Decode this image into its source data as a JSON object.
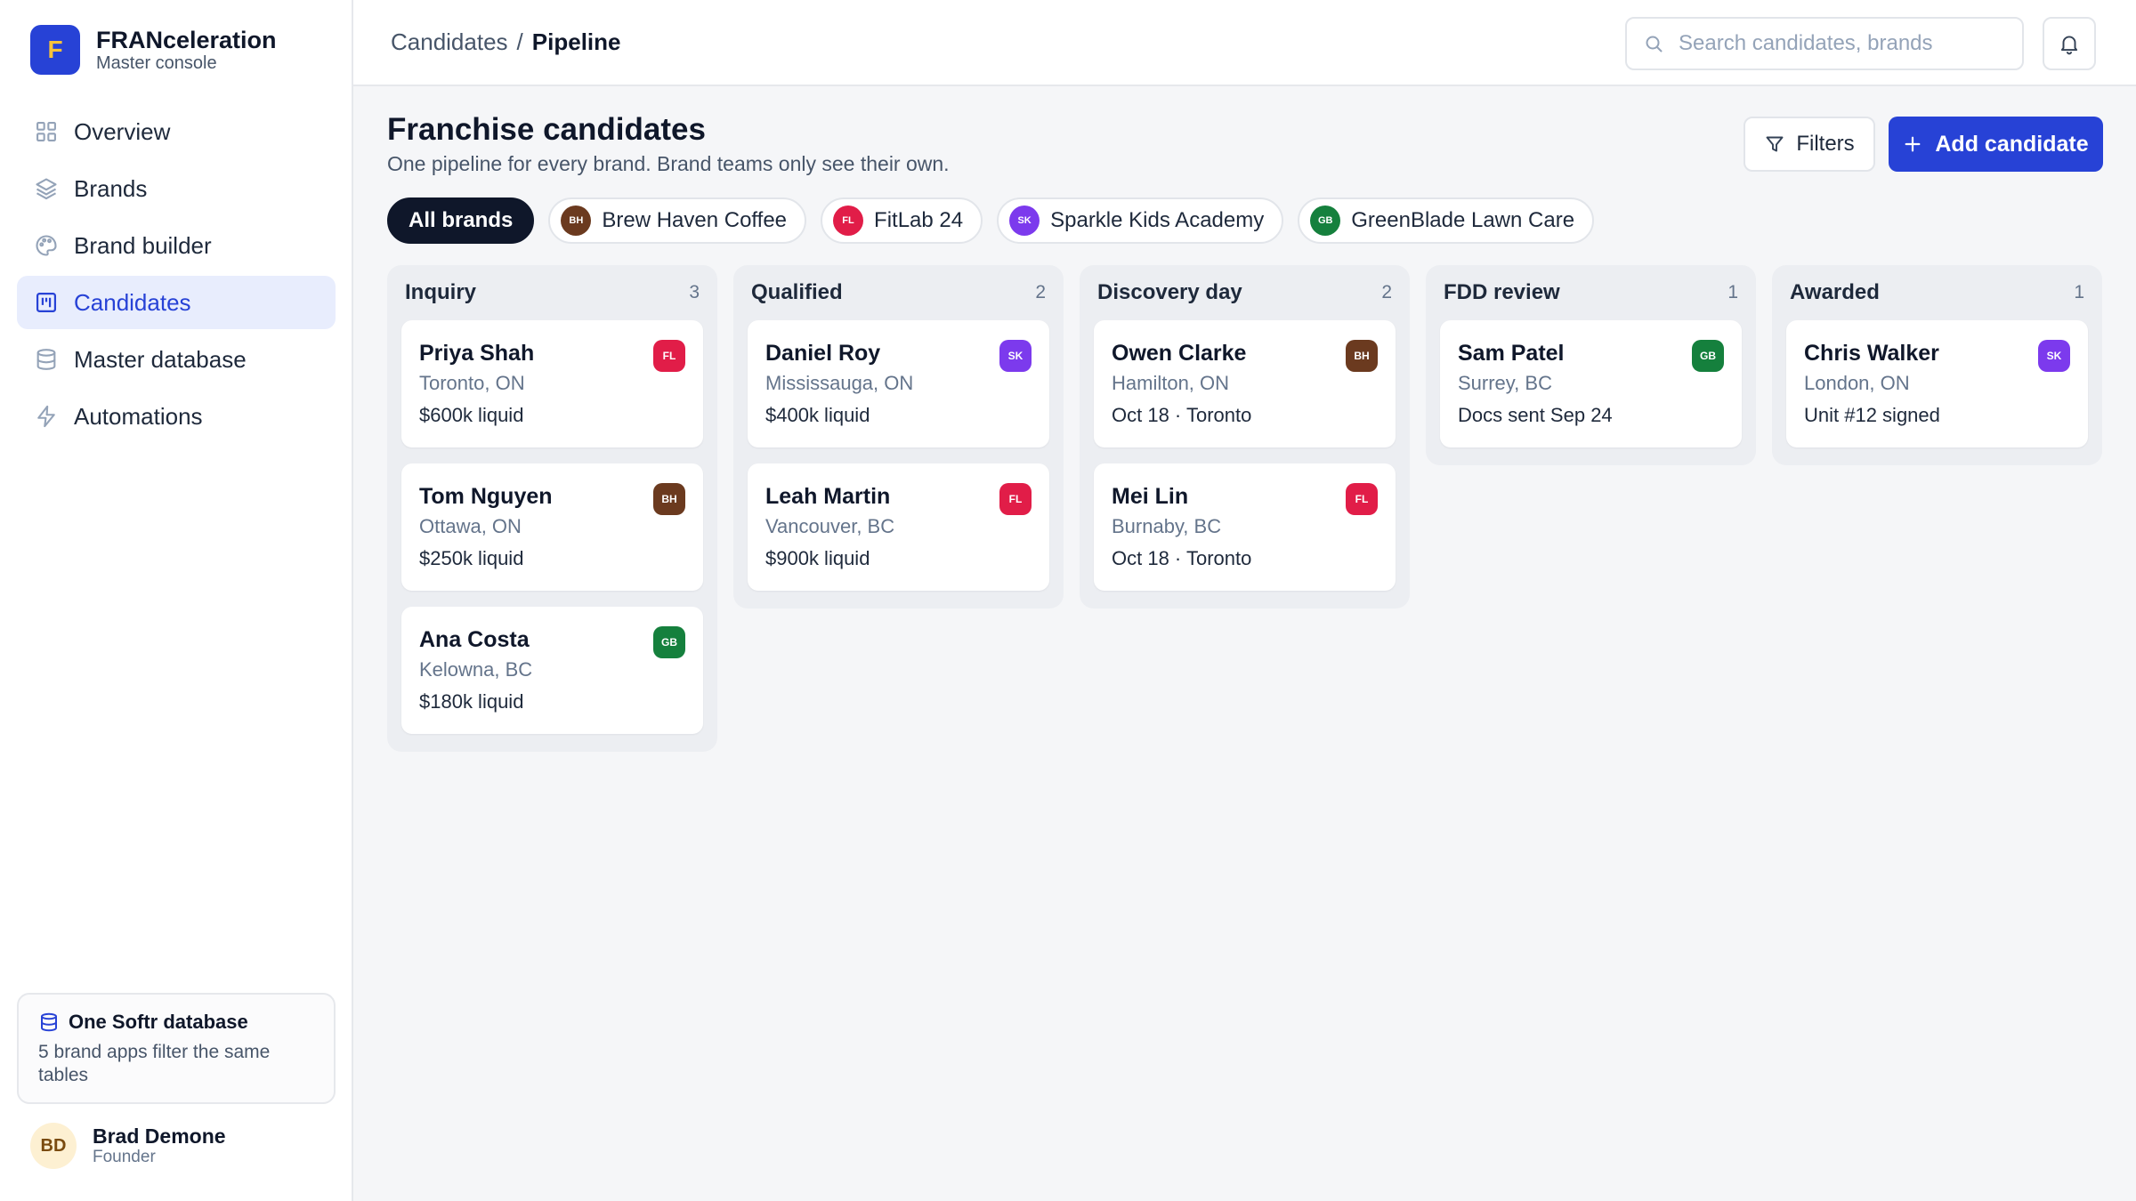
{
  "app": {
    "name": "FRANceleration",
    "subtitle": "Master console",
    "logo_letter": "F"
  },
  "colors": {
    "primary": "#2742d6",
    "logo_letter": "#f8c23a",
    "brew_haven": "#6b3a1f",
    "fitlab": "#e11d48",
    "sparkle": "#7c3aed",
    "greenblade": "#15803d"
  },
  "nav": {
    "items": [
      {
        "label": "Overview",
        "icon": "grid-icon"
      },
      {
        "label": "Brands",
        "icon": "layers-icon"
      },
      {
        "label": "Brand builder",
        "icon": "palette-icon"
      },
      {
        "label": "Candidates",
        "icon": "kanban-icon",
        "active": true
      },
      {
        "label": "Master database",
        "icon": "database-icon"
      },
      {
        "label": "Automations",
        "icon": "bolt-icon"
      }
    ]
  },
  "db_card": {
    "title": "One Softr database",
    "description": "5 brand apps filter the same tables"
  },
  "user": {
    "initials": "BD",
    "name": "Brad Demone",
    "role": "Founder"
  },
  "breadcrumb": {
    "parent": "Candidates",
    "separator": "/",
    "current": "Pipeline"
  },
  "search": {
    "placeholder": "Search candidates, brands",
    "value": ""
  },
  "page": {
    "title": "Franchise candidates",
    "subtitle": "One pipeline for every brand. Brand teams only see their own."
  },
  "toolbar": {
    "filters_label": "Filters",
    "add_label": "Add candidate"
  },
  "brand_chips": {
    "all_label": "All brands",
    "items": [
      {
        "abbr": "BH",
        "label": "Brew Haven Coffee",
        "color": "#6b3a1f"
      },
      {
        "abbr": "FL",
        "label": "FitLab 24",
        "color": "#e11d48"
      },
      {
        "abbr": "SK",
        "label": "Sparkle Kids Academy",
        "color": "#7c3aed"
      },
      {
        "abbr": "GB",
        "label": "GreenBlade Lawn Care",
        "color": "#15803d"
      }
    ]
  },
  "columns": [
    {
      "title": "Inquiry",
      "count": "3",
      "cards": [
        {
          "name": "Priya Shah",
          "location": "Toronto, ON",
          "detail": "$600k liquid",
          "brand": "FL",
          "color": "#e11d48"
        },
        {
          "name": "Tom Nguyen",
          "location": "Ottawa, ON",
          "detail": "$250k liquid",
          "brand": "BH",
          "color": "#6b3a1f"
        },
        {
          "name": "Ana Costa",
          "location": "Kelowna, BC",
          "detail": "$180k liquid",
          "brand": "GB",
          "color": "#15803d"
        }
      ]
    },
    {
      "title": "Qualified",
      "count": "2",
      "cards": [
        {
          "name": "Daniel Roy",
          "location": "Mississauga, ON",
          "detail": "$400k liquid",
          "brand": "SK",
          "color": "#7c3aed"
        },
        {
          "name": "Leah Martin",
          "location": "Vancouver, BC",
          "detail": "$900k liquid",
          "brand": "FL",
          "color": "#e11d48"
        }
      ]
    },
    {
      "title": "Discovery day",
      "count": "2",
      "cards": [
        {
          "name": "Owen Clarke",
          "location": "Hamilton, ON",
          "detail": "Oct 18 · Toronto",
          "brand": "BH",
          "color": "#6b3a1f"
        },
        {
          "name": "Mei Lin",
          "location": "Burnaby, BC",
          "detail": "Oct 18 · Toronto",
          "brand": "FL",
          "color": "#e11d48"
        }
      ]
    },
    {
      "title": "FDD review",
      "count": "1",
      "cards": [
        {
          "name": "Sam Patel",
          "location": "Surrey, BC",
          "detail": "Docs sent Sep 24",
          "brand": "GB",
          "color": "#15803d"
        }
      ]
    },
    {
      "title": "Awarded",
      "count": "1",
      "cards": [
        {
          "name": "Chris Walker",
          "location": "London, ON",
          "detail": "Unit #12 signed",
          "brand": "SK",
          "color": "#7c3aed"
        }
      ]
    }
  ]
}
